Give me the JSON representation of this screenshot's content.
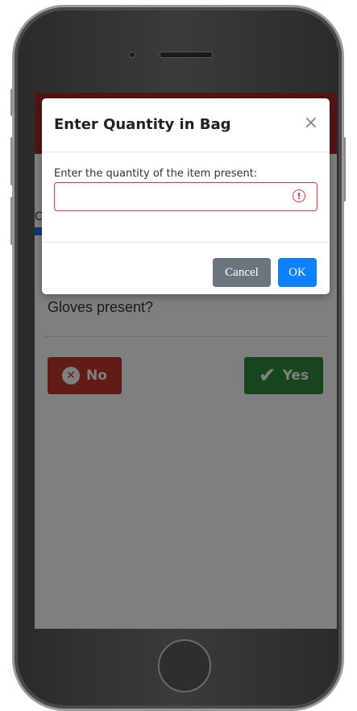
{
  "modal": {
    "title": "Enter Quantity in Bag",
    "close_symbol": "×",
    "label": "Enter the quantity of the item present:",
    "input_value": "",
    "input_placeholder": "",
    "warning_symbol": "!",
    "cancel_label": "Cancel",
    "ok_label": "OK"
  },
  "background_screen": {
    "partial_label": "C",
    "question": "Gloves present?",
    "no_label": "No",
    "no_icon": "x-circle-icon",
    "yes_label": "Yes",
    "yes_icon": "check-icon"
  },
  "colors": {
    "header": "#a52a2a",
    "no_button": "#c0392b",
    "yes_button": "#2e8b3a",
    "ok_button": "#0d80ff",
    "cancel_button": "#6c757d",
    "error_border": "#dc3545"
  }
}
